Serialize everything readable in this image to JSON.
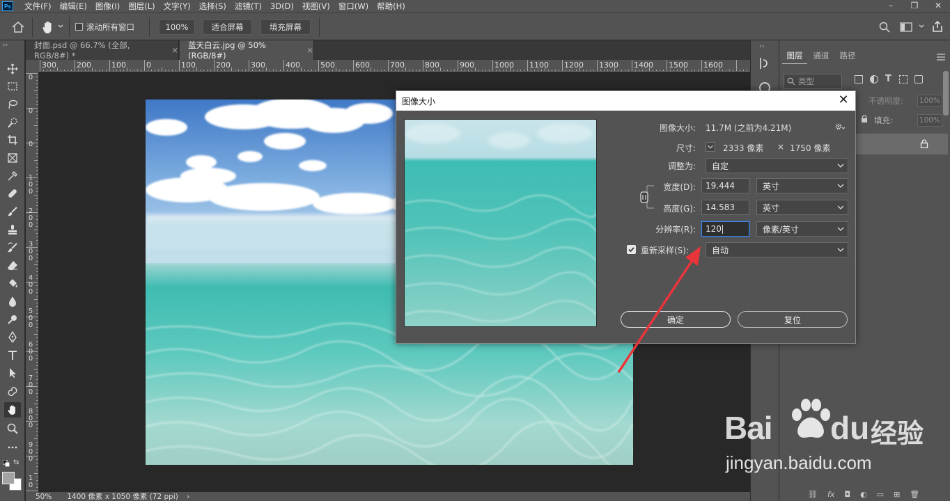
{
  "app": {
    "logo": "Ps",
    "menu": [
      "文件(F)",
      "编辑(E)",
      "图像(I)",
      "图层(L)",
      "文字(Y)",
      "选择(S)",
      "滤镜(T)",
      "3D(D)",
      "视图(V)",
      "窗口(W)",
      "帮助(H)"
    ],
    "window_controls": [
      "–",
      "❐",
      "✕"
    ]
  },
  "options": {
    "scroll_all_label": "滚动所有窗口",
    "scroll_all_checked": false,
    "zoom_value": "100%",
    "fit_screen_label": "适合屏幕",
    "fill_screen_label": "填充屏幕"
  },
  "tabs": [
    {
      "label": "封面.psd @ 66.7% (全部, RGB/8#) *",
      "close": "×",
      "active": false
    },
    {
      "label": "蓝天白云.jpg @ 50%(RGB/8#)",
      "close": "×",
      "active": true
    }
  ],
  "ruler": {
    "h_labels": [
      "300",
      "200",
      "100",
      "0",
      "100",
      "200",
      "300",
      "400",
      "500",
      "600",
      "700",
      "800",
      "900",
      "1000",
      "1100",
      "1200",
      "1300",
      "1400",
      "1500",
      "1600"
    ],
    "v_labels": [
      "0",
      "0",
      "0",
      "1 0 0",
      "2 0 0",
      "3 0 0",
      "4 0 0",
      "5 0 0",
      "6 0 0",
      "7 0 0",
      "8 0 0",
      "9 0 0",
      "1 0"
    ]
  },
  "status": {
    "zoom": "50%",
    "doc_info": "1400 像素 x 1050 像素 (72 ppi)",
    "arrow": "›"
  },
  "panels": {
    "tabs": [
      "图层",
      "通道",
      "路径"
    ],
    "kind_label": "类型",
    "opacity_label": "不透明度:",
    "opacity_value": "100%",
    "fill_label": "填充:",
    "fill_value": "100%"
  },
  "dialog": {
    "title": "图像大小",
    "close": "✕",
    "image_size_label": "图像大小:",
    "image_size_value": "11.7M (之前为4.21M)",
    "dimensions_label": "尺寸:",
    "dimensions_width": "2333 像素",
    "dimensions_times": "×",
    "dimensions_height": "1750 像素",
    "fit_to_label": "调整为:",
    "fit_to_value": "自定",
    "width_label": "宽度(D):",
    "width_value": "19.444",
    "width_unit": "英寸",
    "height_label": "高度(G):",
    "height_value": "14.583",
    "height_unit": "英寸",
    "resolution_label": "分辨率(R):",
    "resolution_value": "120",
    "resolution_unit": "像素/英寸",
    "resample_label": "重新采样(S):",
    "resample_checked": true,
    "resample_value": "自动",
    "ok_label": "确定",
    "reset_label": "复位"
  },
  "watermark": {
    "brand_left": "Bai",
    "brand_right": "du",
    "brand_cn": "经验",
    "url": "jingyan.baidu.com"
  },
  "colors": {
    "accent_focus": "#4a88d8",
    "annotation_arrow": "#e8353b",
    "ui_panel": "#535353",
    "canvas_bg": "#282828"
  }
}
